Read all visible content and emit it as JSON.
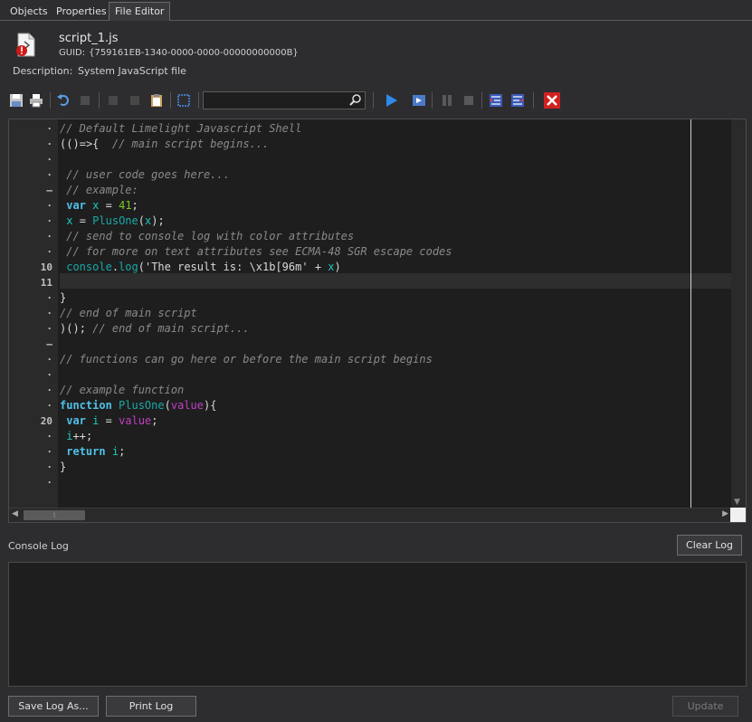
{
  "tabs": [
    {
      "label": "Objects"
    },
    {
      "label": "Properties"
    },
    {
      "label": "File Editor"
    }
  ],
  "file": {
    "name": "script_1.js",
    "guid_label": "GUID:",
    "guid": "{759161EB-1340-0000-0000-00000000000B}",
    "description_label": "Description:",
    "description": "System JavaScript file"
  },
  "toolbar": {
    "icons": [
      "save-icon",
      "print-icon",
      "undo-icon",
      "redo-icon",
      "cut-icon",
      "copy-icon",
      "paste-icon",
      "select-all-icon",
      "search-icon",
      "run-icon",
      "step-icon",
      "pause-icon",
      "stop-icon",
      "indent-icon",
      "outdent-icon",
      "close-icon"
    ],
    "search_value": ""
  },
  "editor": {
    "line_markers": [
      "·",
      "·",
      "·",
      "·",
      "–",
      "·",
      "·",
      "·",
      "·",
      "10",
      "11",
      "·",
      "·",
      "·",
      "–",
      "·",
      "·",
      "·",
      "·",
      "20",
      "·",
      "·",
      "·",
      "·"
    ],
    "lines": [
      "// Default Limelight Javascript Shell",
      "(()=>{  // main script begins...",
      "",
      " // user code goes here...",
      " // example:",
      " var x = 41;",
      " x = PlusOne(x);",
      " // send to console log with color attributes",
      " // for more on text attributes see ECMA-48 SGR escape codes",
      " console.log('The result is: \\x1b[96m' + x)",
      "",
      "}",
      "// end of main script",
      ")(); // end of main script...",
      "",
      "// functions can go here or before the main script begins",
      "",
      "// example function",
      "function PlusOne(value){",
      " var i = value;",
      " i++;",
      " return i;",
      "}",
      ""
    ]
  },
  "console": {
    "label": "Console Log",
    "clear_label": "Clear Log",
    "save_label": "Save Log As...",
    "print_label": "Print Log",
    "update_label": "Update"
  },
  "colors": {
    "background": "#2d2d30",
    "editor_bg": "#1e1e1e",
    "comment": "#8a8a8a",
    "keyword": "#4fc1e9",
    "variable": "#1ec8b8",
    "number": "#7ec820",
    "parameter": "#c040c0",
    "accent_close": "#d02020"
  }
}
